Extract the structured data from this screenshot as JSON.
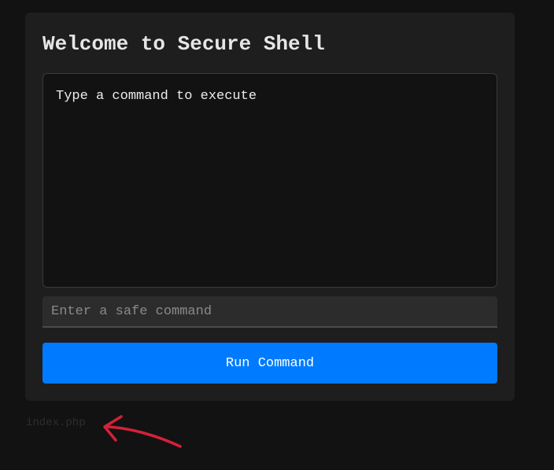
{
  "panel": {
    "title": "Welcome to Secure Shell",
    "output_text": "Type a command to execute",
    "command_input": {
      "value": "",
      "placeholder": "Enter a safe command"
    },
    "run_button_label": "Run Command"
  },
  "footer": {
    "filename": "index.php"
  },
  "annotation": {
    "arrow_icon": "hand-drawn-arrow-icon",
    "color": "#d4213a"
  },
  "colors": {
    "background": "#121212",
    "panel": "#1e1e1e",
    "accent": "#007bff"
  }
}
